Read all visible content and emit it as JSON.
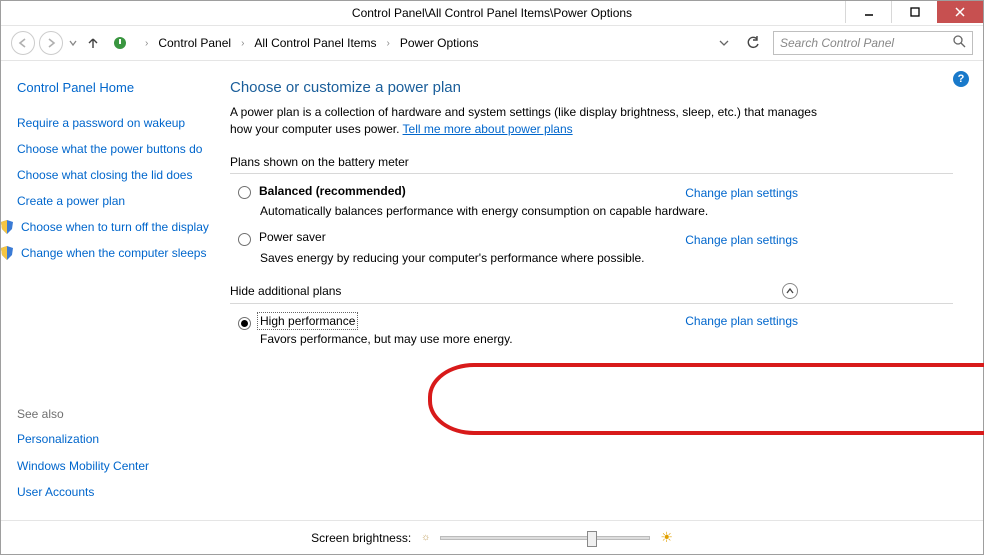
{
  "titlebar": {
    "title": "Control Panel\\All Control Panel Items\\Power Options"
  },
  "nav": {
    "breadcrumb": [
      "Control Panel",
      "All Control Panel Items",
      "Power Options"
    ],
    "search_placeholder": "Search Control Panel"
  },
  "sidebar": {
    "home": "Control Panel Home",
    "links": [
      "Require a password on wakeup",
      "Choose what the power buttons do",
      "Choose what closing the lid does",
      "Create a power plan",
      "Choose when to turn off the display",
      "Change when the computer sleeps"
    ],
    "see_also_head": "See also",
    "see_also": [
      "Personalization",
      "Windows Mobility Center",
      "User Accounts"
    ]
  },
  "main": {
    "heading": "Choose or customize a power plan",
    "description": "A power plan is a collection of hardware and system settings (like display brightness, sleep, etc.) that manages how your computer uses power. ",
    "learn_more": "Tell me more about power plans",
    "plans_label": "Plans shown on the battery meter",
    "hide_label": "Hide additional plans",
    "change_link": "Change plan settings",
    "plans": [
      {
        "name": "Balanced (recommended)",
        "desc": "Automatically balances performance with energy consumption on capable hardware.",
        "checked": false,
        "bold": true
      },
      {
        "name": "Power saver",
        "desc": "Saves energy by reducing your computer's performance where possible.",
        "checked": false,
        "bold": false
      },
      {
        "name": "High performance",
        "desc": "Favors performance, but may use more energy.",
        "checked": true,
        "bold": false
      }
    ]
  },
  "footer": {
    "brightness_label": "Screen brightness:"
  }
}
